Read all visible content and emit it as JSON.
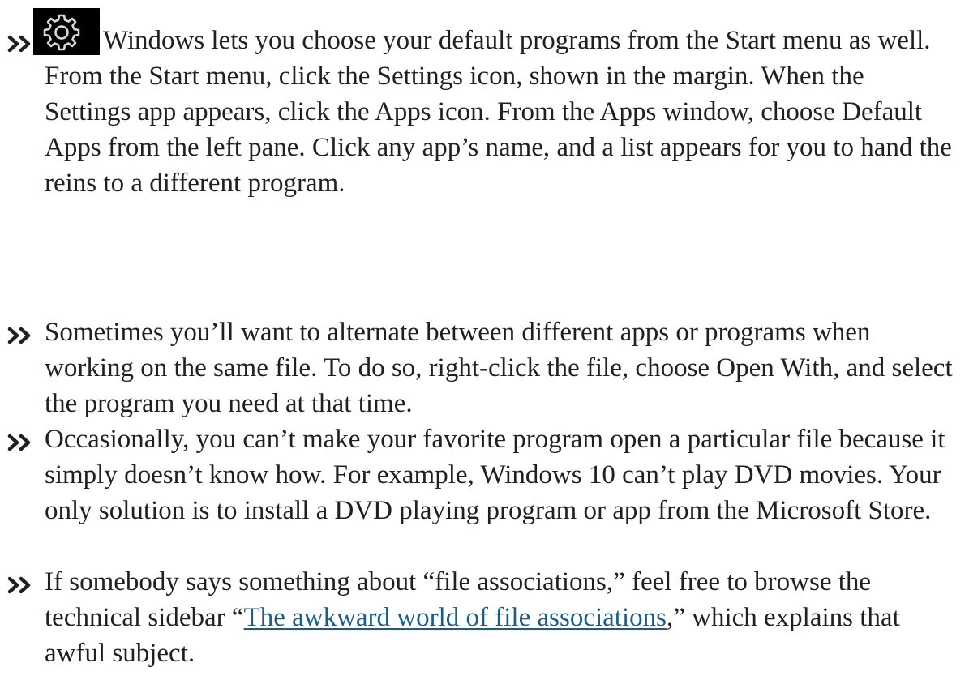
{
  "bullets": [
    {
      "icon": "settings-gear-icon",
      "text": "Windows lets you choose your default programs from the Start menu as well. From the Start menu, click the Settings icon, shown in the margin. When the Settings app appears, click the Apps icon. From the Apps window, choose Default Apps from the left pane. Click any app’s name, and a list appears for you to hand the reins to a different program."
    },
    {
      "text": "Sometimes you’ll want to alternate between different apps or programs when working on the same file. To do so, right-click the file, choose Open With, and select the program you need at that time."
    },
    {
      "text": "Occasionally, you can’t make your favorite program open a particular file because it simply doesn’t know how. For example, Windows 10 can’t play DVD movies. Your only solution is to install a DVD playing program or app from the Microsoft Store."
    },
    {
      "text_before": "If somebody says something about “file associations,” feel free to browse the technical sidebar “",
      "link_text": "The awkward world of file associations",
      "text_after": ",” which explains that awful subject."
    }
  ],
  "colors": {
    "text": "#231f20",
    "link": "#1a5c8a",
    "icon_background": "#000000"
  }
}
